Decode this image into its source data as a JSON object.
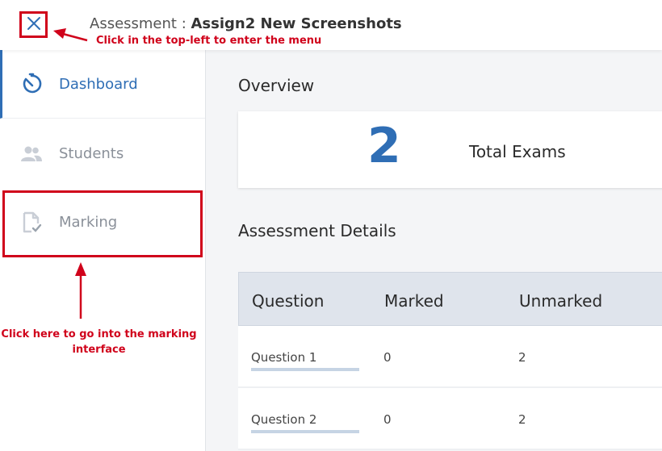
{
  "header": {
    "title_prefix": "Assessment :",
    "title_name": "Assign2 New Screenshots",
    "close_icon": "close-icon"
  },
  "annotations": {
    "top": "Click in the top-left to enter the menu",
    "bottom": "Click here to go into the marking interface",
    "color": "#d0021b"
  },
  "sidebar": {
    "items": [
      {
        "label": "Dashboard",
        "icon": "stopwatch-icon",
        "active": true
      },
      {
        "label": "Students",
        "icon": "users-icon",
        "active": false
      },
      {
        "label": "Marking",
        "icon": "document-check-icon",
        "active": false
      }
    ]
  },
  "overview": {
    "title": "Overview",
    "stat_value": "2",
    "stat_label": "Total Exams"
  },
  "details": {
    "title": "Assessment Details",
    "columns": [
      "Question",
      "Marked",
      "Unmarked"
    ],
    "rows": [
      {
        "question": "Question 1",
        "marked": "0",
        "unmarked": "2"
      },
      {
        "question": "Question 2",
        "marked": "0",
        "unmarked": "2"
      }
    ]
  },
  "colors": {
    "accent": "#2f6eb5",
    "highlight": "#d0021b"
  }
}
